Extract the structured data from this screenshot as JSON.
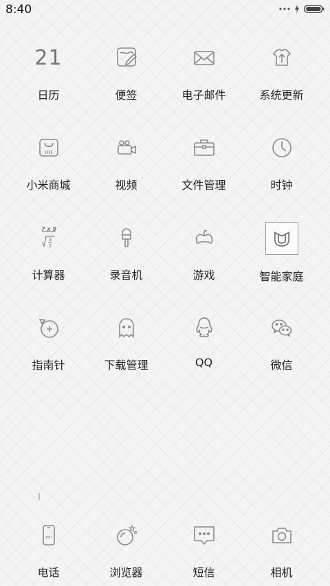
{
  "status_bar": {
    "time": "8:40",
    "icons": [
      "more-dots-icon",
      "charging-bolt-icon",
      "battery-icon"
    ]
  },
  "apps": [
    {
      "label": "日历",
      "icon": "calendar-icon",
      "day": "21"
    },
    {
      "label": "便签",
      "icon": "notes-icon"
    },
    {
      "label": "电子邮件",
      "icon": "email-icon"
    },
    {
      "label": "系统更新",
      "icon": "system-update-icon"
    },
    {
      "label": "小米商城",
      "icon": "mi-store-icon"
    },
    {
      "label": "视频",
      "icon": "video-icon"
    },
    {
      "label": "文件管理",
      "icon": "file-manager-icon"
    },
    {
      "label": "时钟",
      "icon": "clock-icon"
    },
    {
      "label": "计算器",
      "icon": "calculator-icon",
      "glyph_top": "7 x 9",
      "glyph_frac_top": "3",
      "glyph_frac_bottom": "2"
    },
    {
      "label": "录音机",
      "icon": "recorder-icon"
    },
    {
      "label": "游戏",
      "icon": "game-icon"
    },
    {
      "label": "智能家庭",
      "icon": "smart-home-icon"
    },
    {
      "label": "指南针",
      "icon": "compass-icon"
    },
    {
      "label": "下载管理",
      "icon": "download-manager-icon"
    },
    {
      "label": "QQ",
      "icon": "qq-icon"
    },
    {
      "label": "微信",
      "icon": "wechat-icon"
    }
  ],
  "dock": [
    {
      "label": "电话",
      "icon": "phone-icon",
      "glyph": "mi"
    },
    {
      "label": "浏览器",
      "icon": "browser-icon"
    },
    {
      "label": "短信",
      "icon": "messages-icon"
    },
    {
      "label": "相机",
      "icon": "camera-icon"
    }
  ],
  "colors": {
    "icon_stroke": "#8a8a8a",
    "label": "#222222",
    "background": "#f4f4f4"
  }
}
